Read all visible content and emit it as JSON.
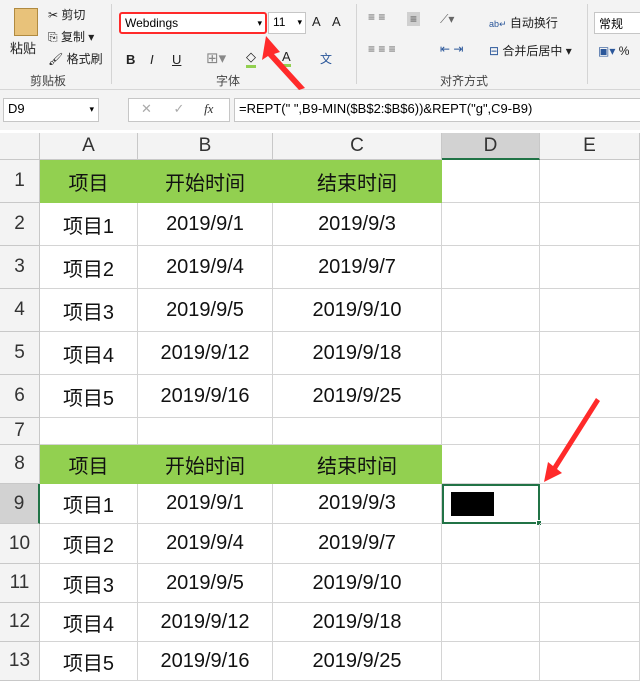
{
  "ribbon": {
    "paste": "粘贴",
    "cut": "剪切",
    "copy": "复制",
    "format_painter": "格式刷",
    "clipboard_group": "剪贴板",
    "font_name": "Webdings",
    "font_size": "11",
    "bold": "B",
    "italic": "I",
    "underline": "U",
    "font_group": "字体",
    "wrap_text": "自动换行",
    "merge_center": "合并后居中",
    "align_group": "对齐方式",
    "number_format": "常规",
    "grow_font": "A",
    "shrink_font": "A",
    "phonetic": "文",
    "percent": "%"
  },
  "formula_bar": {
    "name_box": "D9",
    "fx": "fx",
    "formula": "=REPT(\" \",B9-MIN($B$2:$B$6))&REPT(\"g\",C9-B9)"
  },
  "columns": [
    "A",
    "B",
    "C",
    "D",
    "E"
  ],
  "rows": [
    "1",
    "2",
    "3",
    "4",
    "5",
    "6",
    "7",
    "8",
    "9",
    "10",
    "11",
    "12",
    "13"
  ],
  "table1": {
    "headers": [
      "项目",
      "开始时间",
      "结束时间"
    ],
    "data": [
      [
        "项目1",
        "2019/9/1",
        "2019/9/3"
      ],
      [
        "项目2",
        "2019/9/4",
        "2019/9/7"
      ],
      [
        "项目3",
        "2019/9/5",
        "2019/9/10"
      ],
      [
        "项目4",
        "2019/9/12",
        "2019/9/18"
      ],
      [
        "项目5",
        "2019/9/16",
        "2019/9/25"
      ]
    ]
  },
  "table2": {
    "headers": [
      "项目",
      "开始时间",
      "结束时间"
    ],
    "data": [
      [
        "项目1",
        "2019/9/1",
        "2019/9/3"
      ],
      [
        "项目2",
        "2019/9/4",
        "2019/9/7"
      ],
      [
        "项目3",
        "2019/9/5",
        "2019/9/10"
      ],
      [
        "项目4",
        "2019/9/12",
        "2019/9/18"
      ],
      [
        "项目5",
        "2019/9/16",
        "2019/9/25"
      ]
    ]
  },
  "colors": {
    "header_fill": "#92d050",
    "accent": "#217346",
    "annotation": "#ff2a2a"
  }
}
